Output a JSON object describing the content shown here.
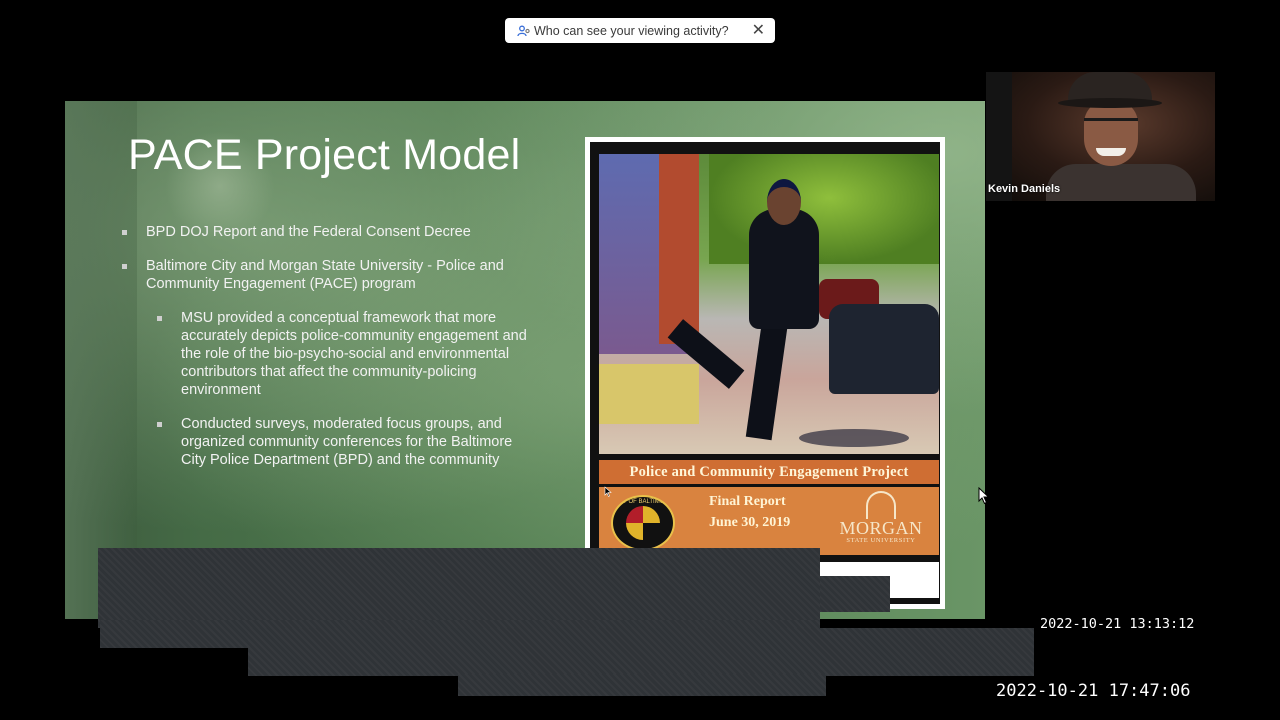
{
  "privacy_pill": {
    "text": "Who can see your viewing activity?",
    "close_glyph": "✕",
    "icon": "people-icon"
  },
  "slide": {
    "title": "PACE Project Model",
    "bullets": [
      "BPD DOJ Report and the Federal Consent Decree",
      "Baltimore City and Morgan State University -  Police and Community Engagement (PACE) program"
    ],
    "sub_bullets": [
      "MSU provided a conceptual framework that more accurately depicts police-community engagement and the role of the bio-psycho-social and environmental contributors that affect the community-policing environment",
      "Conducted surveys, moderated focus groups, and organized community conferences for the Baltimore City Police Department (BPD) and the community"
    ],
    "cover": {
      "banner": "Police and Community Engagement Project",
      "final_report": "Final Report",
      "date": "June 30, 2019",
      "seal_text": "CITY OF BALTIMORE",
      "university_name": "MORGAN",
      "university_sub": "STATE UNIVERSITY"
    }
  },
  "participant": {
    "name": "Kevin Daniels"
  },
  "timestamps": {
    "upper": "2022-10-21 13:13:12",
    "lower": "2022-10-21 17:47:06"
  },
  "colors": {
    "banner": "#cf6e33",
    "slide_green": "#4f7a4e"
  }
}
